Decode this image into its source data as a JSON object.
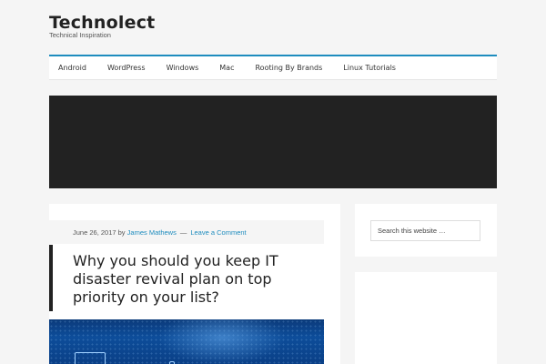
{
  "site": {
    "title": "Technolect",
    "description": "Technical Inspiration"
  },
  "nav": {
    "items": [
      {
        "label": "Android"
      },
      {
        "label": "WordPress"
      },
      {
        "label": "Windows"
      },
      {
        "label": "Mac"
      },
      {
        "label": "Rooting By Brands"
      },
      {
        "label": "Linux Tutorials"
      }
    ]
  },
  "post": {
    "date": "June 26, 2017",
    "by": "by",
    "author": "James Mathews",
    "separator": "—",
    "comments_link": "Leave a Comment",
    "title": "Why you should you keep IT disaster revival plan on top priority on your list?"
  },
  "sidebar": {
    "search_placeholder": "Search this website …"
  },
  "colors": {
    "accent": "#1e8cbe",
    "banner": "#222222",
    "background": "#f5f5f5"
  }
}
